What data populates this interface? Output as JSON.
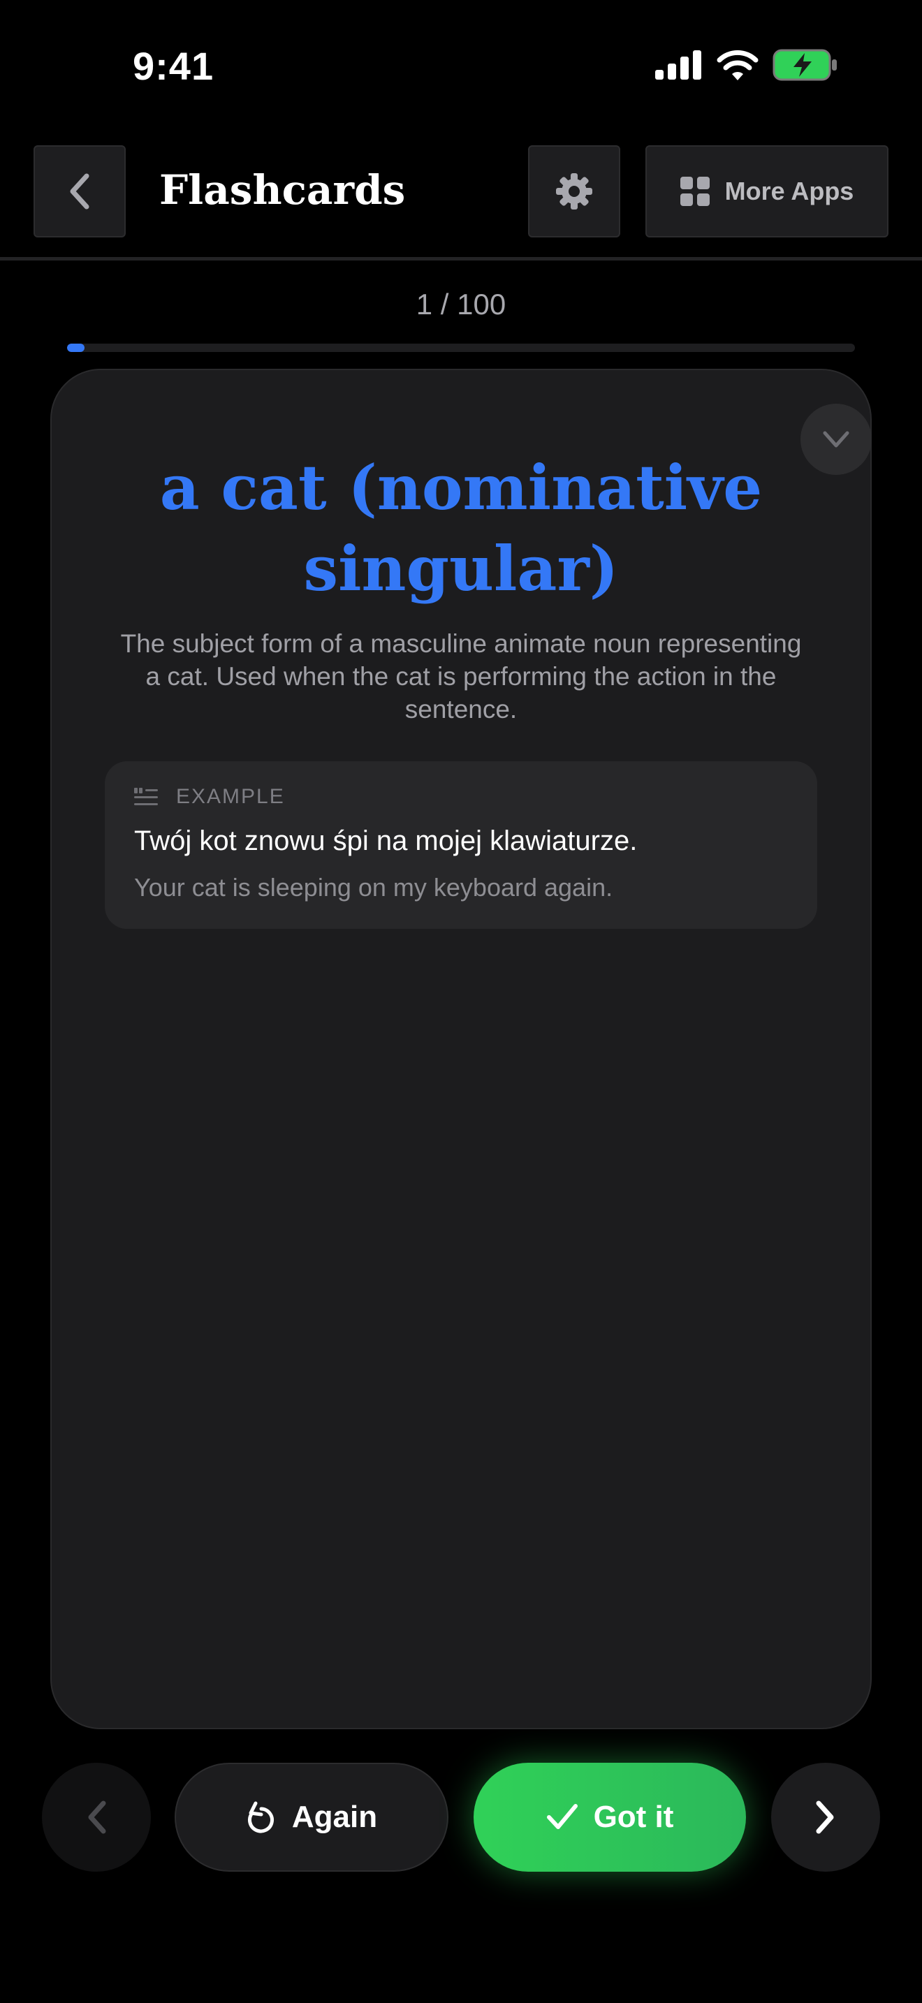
{
  "status_bar": {
    "time": "9:41"
  },
  "header": {
    "title": "Flashcards",
    "more_apps_label": "More Apps"
  },
  "progress": {
    "text": "1 / 100",
    "current": 1,
    "total": 100
  },
  "card": {
    "term": "a cat (nominative singular)",
    "definition": "The subject form of a masculine animate noun representing a cat. Used when the cat is performing the action in the sentence.",
    "example": {
      "label": "EXAMPLE",
      "source": "Twój kot znowu śpi na mojej klawiaturze.",
      "translation": "Your cat is sleeping on my keyboard again."
    }
  },
  "controls": {
    "again_label": "Again",
    "got_it_label": "Got it"
  },
  "colors": {
    "accent": "#3478f6",
    "success": "#30d158",
    "background": "#000000",
    "card": "#1c1c1e"
  },
  "icons": [
    "chevron-left-icon",
    "gear-icon",
    "grid-icon",
    "chevron-down-icon",
    "quote-icon",
    "undo-icon",
    "checkmark-icon",
    "chevron-right-icon",
    "signal-icon",
    "wifi-icon",
    "battery-icon"
  ]
}
